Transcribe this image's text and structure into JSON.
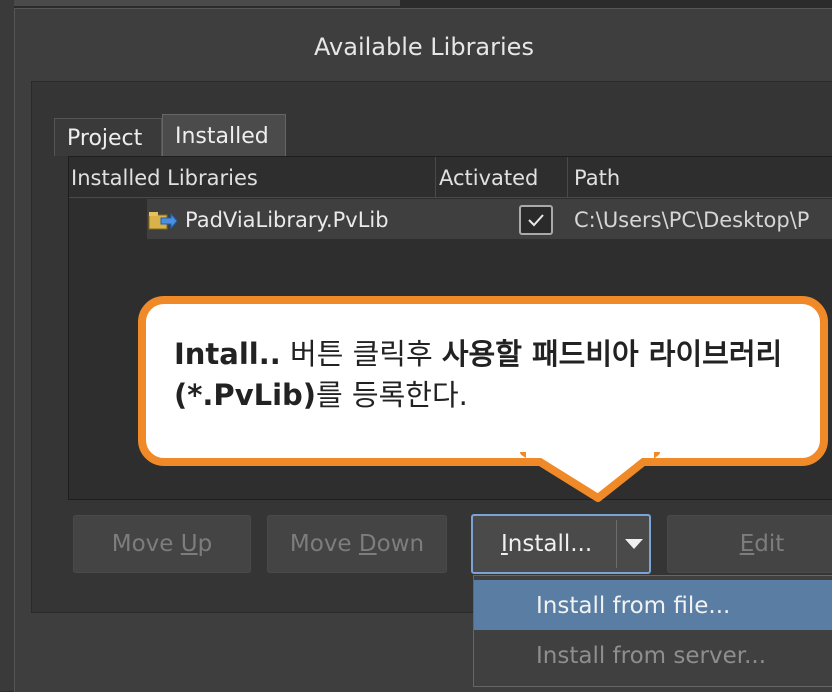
{
  "dialog": {
    "title": "Available Libraries"
  },
  "tabs": [
    {
      "label": "Project"
    },
    {
      "label": "Installed"
    }
  ],
  "columns": {
    "name": "Installed Libraries",
    "activated": "Activated",
    "path": "Path"
  },
  "library_row": {
    "name": "PadViaLibrary.PvLib",
    "activated": true,
    "path": "C:\\Users\\PC\\Desktop\\P"
  },
  "buttons": {
    "move_up": {
      "prefix": "Move ",
      "mnemonic": "U",
      "suffix": "p"
    },
    "move_down": {
      "prefix": "Move ",
      "mnemonic": "D",
      "suffix": "own"
    },
    "install": {
      "mnemonic": "I",
      "suffix": "nstall..."
    },
    "edit": {
      "mnemonic": "E",
      "suffix": "dit"
    }
  },
  "install_menu": [
    {
      "label": "Install from file..."
    },
    {
      "label": "Install from server..."
    }
  ],
  "callout": {
    "part1_bold": "Intall..",
    "part2": " 버튼 클릭후 ",
    "part3_bold": "사용할 패드비아 라이브러리(*.PvLib)",
    "part4": "를 등록한다."
  },
  "colors": {
    "accent_orange": "#f08a28",
    "menu_highlight": "#5a7ea3",
    "install_border": "#7ba3d6"
  }
}
